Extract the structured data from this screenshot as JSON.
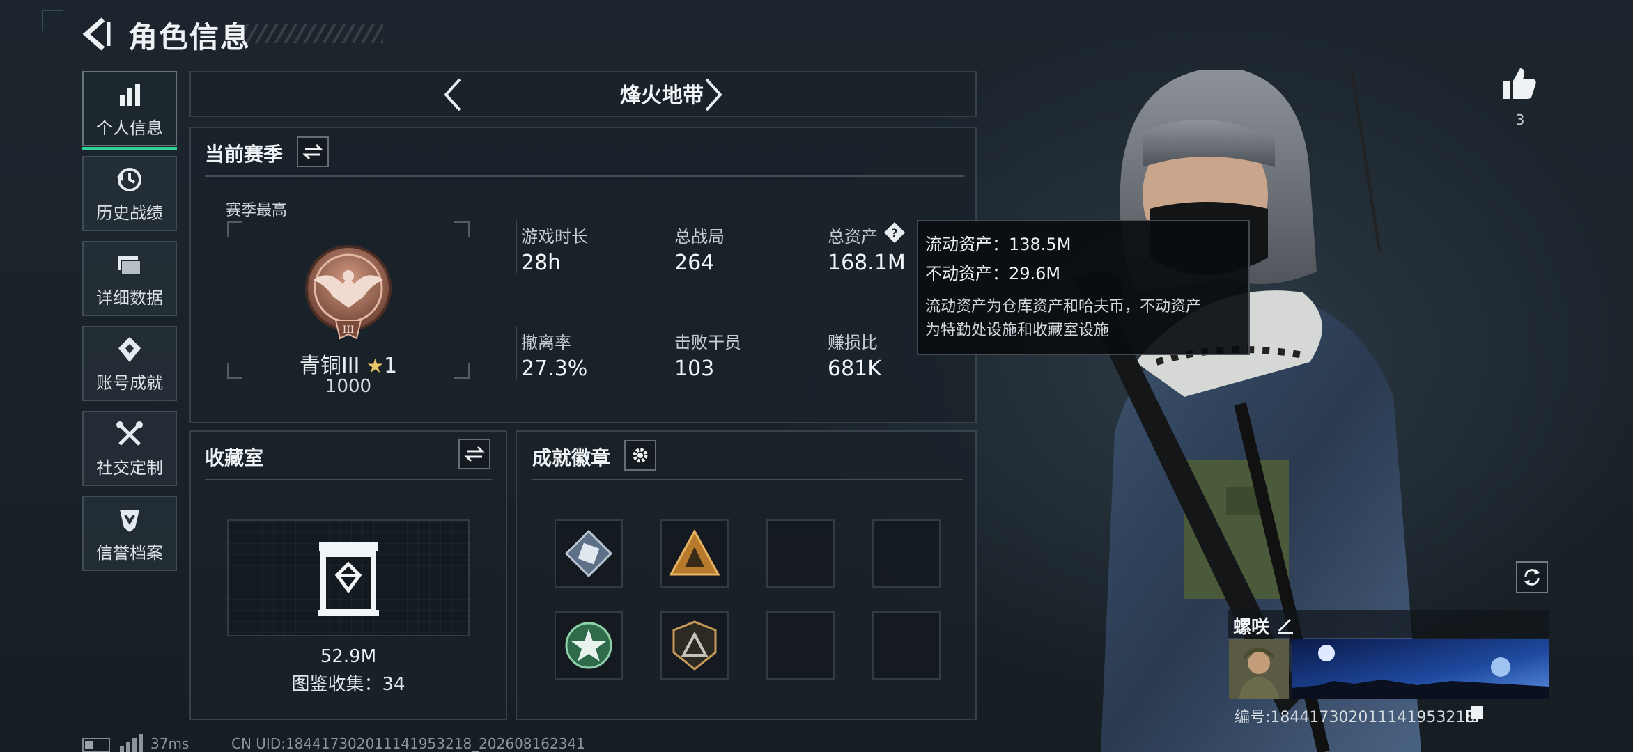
{
  "header": {
    "title": "角色信息"
  },
  "sidebar": {
    "items": [
      {
        "label": "个人信息",
        "icon": "bar-chart-icon",
        "active": true
      },
      {
        "label": "历史战绩",
        "icon": "history-icon",
        "active": false
      },
      {
        "label": "详细数据",
        "icon": "folder-icon",
        "active": false
      },
      {
        "label": "账号成就",
        "icon": "achievement-icon",
        "active": false
      },
      {
        "label": "社交定制",
        "icon": "tools-icon",
        "active": false
      },
      {
        "label": "信誉档案",
        "icon": "credit-icon",
        "active": false
      }
    ]
  },
  "mode": {
    "label": "烽火地带"
  },
  "season": {
    "title": "当前赛季",
    "best_label": "赛季最高",
    "rank_name": "青铜III",
    "rank_stars": "1",
    "rank_score": "1000",
    "stats": [
      {
        "label": "游戏时长",
        "value": "28h"
      },
      {
        "label": "总战局",
        "value": "264"
      },
      {
        "label": "总资产",
        "value": "168.1M"
      },
      {
        "label": "撤离率",
        "value": "27.3%"
      },
      {
        "label": "击败干员",
        "value": "103"
      },
      {
        "label": "赚损比",
        "value": "681K"
      }
    ]
  },
  "tooltip": {
    "liquid": "流动资产：138.5M",
    "fixed": "不动资产：29.6M",
    "note_line1": "流动资产为仓库资产和哈夫币，不动资产",
    "note_line2": "为特勤处设施和收藏室设施"
  },
  "collection": {
    "title": "收藏室",
    "value": "52.9M",
    "count_text": "图鉴收集：34"
  },
  "badges": {
    "title": "成就徽章",
    "slots": [
      "diamond-badge-icon",
      "triangle-badge-icon",
      "empty",
      "empty",
      "star-badge-icon",
      "shield-badge-icon",
      "empty",
      "empty"
    ]
  },
  "profile": {
    "likes": "3",
    "name": "螺咲",
    "id_text": "编号:1844173020111419532​18"
  },
  "footer": {
    "ping": "37ms",
    "uid": "CN UID:1844173020111419532​18_202608162341"
  },
  "colors": {
    "accent": "#2fd39a",
    "bronze": "#a9705a"
  }
}
